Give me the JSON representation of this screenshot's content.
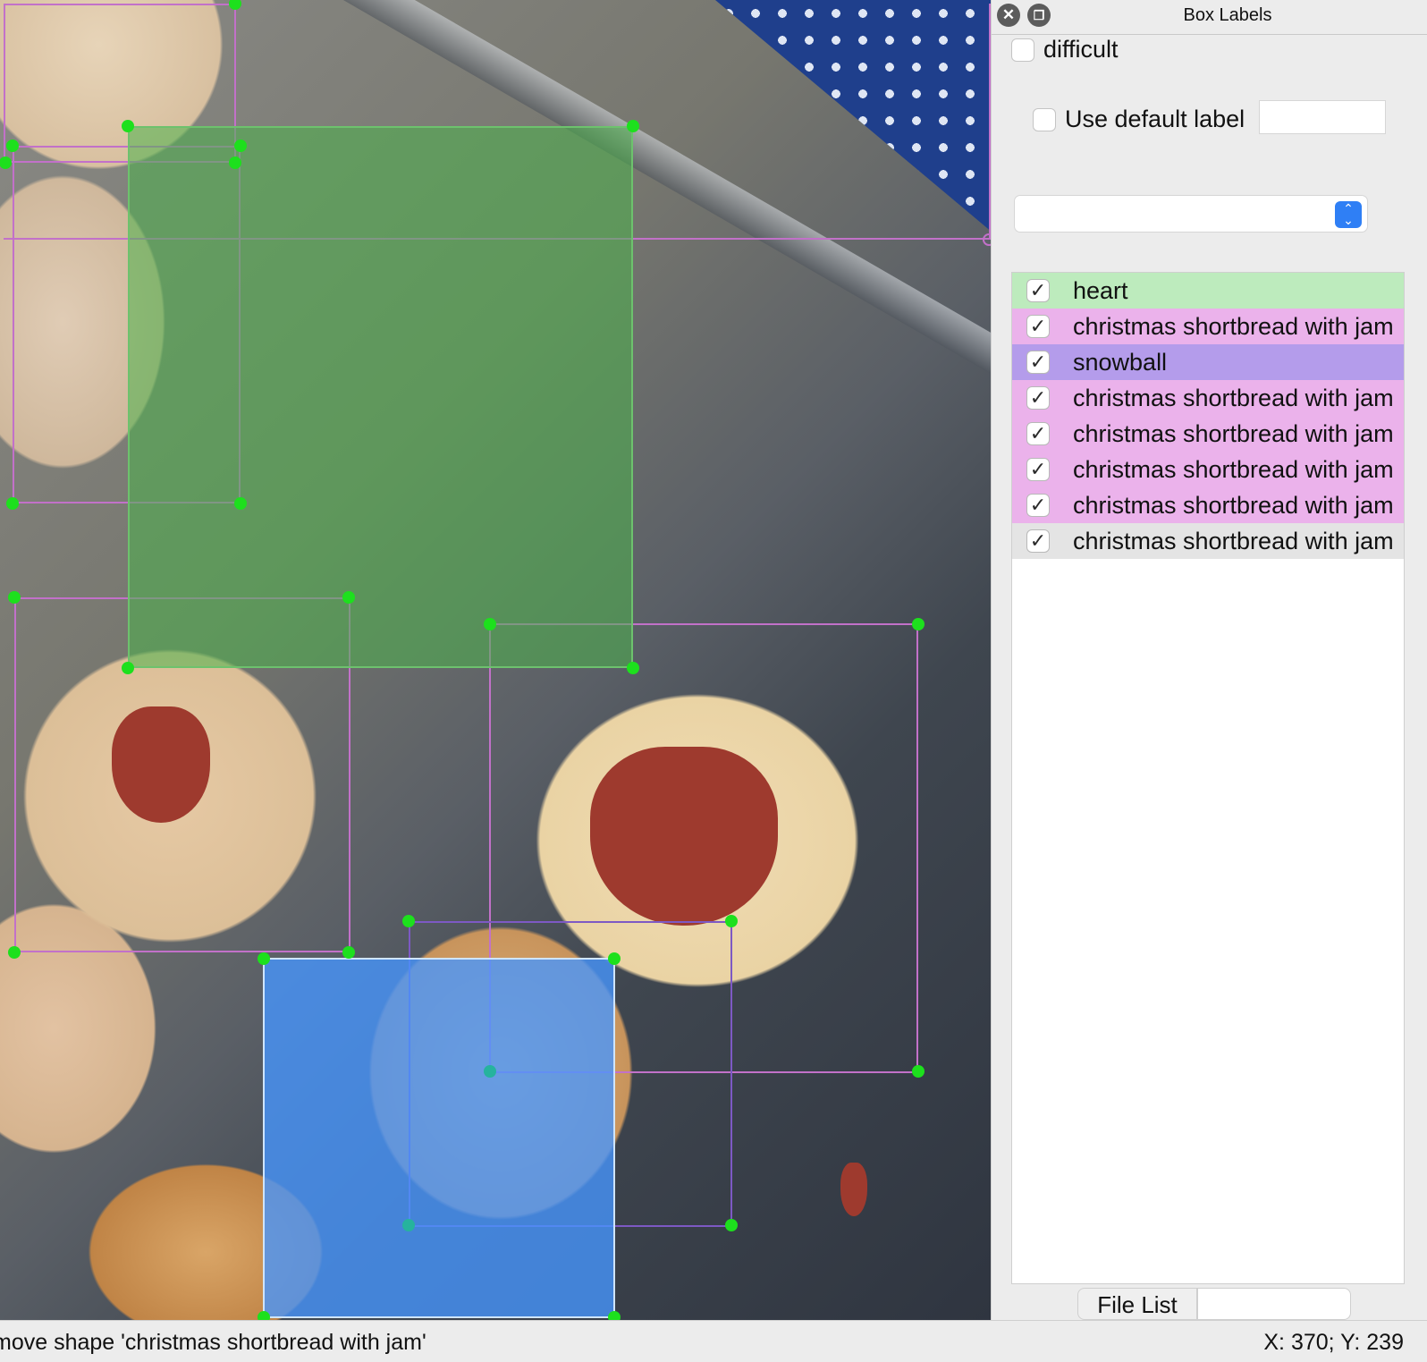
{
  "panel": {
    "title": "Box Labels",
    "difficult_label": "difficult",
    "use_default_label": "Use default label",
    "default_label_value": "",
    "label_combo_value": "",
    "labels": [
      {
        "text": "heart",
        "checked": true,
        "color": "#bdebbd"
      },
      {
        "text": "christmas shortbread with jam",
        "checked": true,
        "color": "#ebb2eb"
      },
      {
        "text": "snowball",
        "checked": true,
        "color": "#b49ceb"
      },
      {
        "text": "christmas shortbread with jam",
        "checked": true,
        "color": "#ebb2eb"
      },
      {
        "text": "christmas shortbread with jam",
        "checked": true,
        "color": "#ebb2eb"
      },
      {
        "text": "christmas shortbread with jam",
        "checked": true,
        "color": "#ebb2eb"
      },
      {
        "text": "christmas shortbread with jam",
        "checked": true,
        "color": "#ebb2eb"
      },
      {
        "text": "christmas shortbread with jam",
        "checked": true,
        "color": "#e4e4e4"
      }
    ],
    "tabs": {
      "file_list": "File List"
    }
  },
  "status": {
    "message": "move shape 'christmas shortbread with jam'",
    "coords": "X: 370; Y: 239"
  },
  "icons": {
    "close": "close-icon",
    "float": "float-window-icon",
    "check": "checkmark-icon",
    "dropdown": "up-down-chevron-icon"
  },
  "colors": {
    "heart_box": "#4cb24c",
    "snowball_box": "#4696ff",
    "shortbread_box": "#c271c9",
    "handle": "#1de01d"
  }
}
